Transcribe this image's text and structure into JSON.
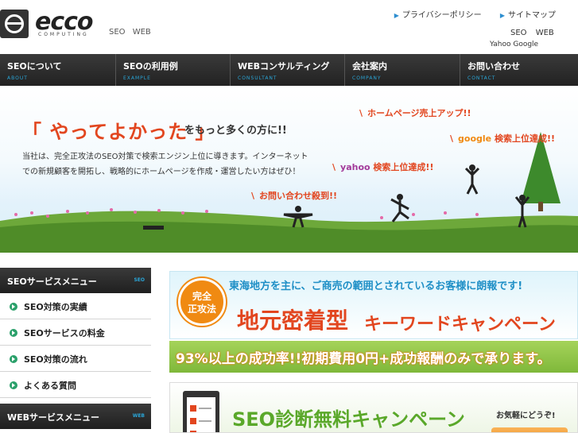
{
  "header": {
    "logo_text": "ecco",
    "logo_sub": "COMPUTING",
    "tagline": "SEO WEB",
    "util_links": [
      "プライバシーポリシー",
      "サイトマップ"
    ],
    "right_line1": "SEO WEB",
    "right_line2": "Yahoo Google"
  },
  "nav": [
    {
      "label": "SEOについて",
      "en": "ABOUT"
    },
    {
      "label": "SEOの利用例",
      "en": "EXAMPLE"
    },
    {
      "label": "WEBコンサルティング",
      "en": "CONSULTANT"
    },
    {
      "label": "会社案内",
      "en": "COMPANY"
    },
    {
      "label": "お問い合わせ",
      "en": "CONTACT"
    }
  ],
  "hero": {
    "title": "「 やってよかった 」",
    "title_sub": "をもっと多くの方に!!",
    "body": "当社は、完全正攻法のSEO対策で検索エンジン上位に導きます。インターネットでの新規顧客を開拓し、戦略的にホームページを作成・運営したい方はぜひ！",
    "tag1": "ホームページ売上アップ!!",
    "tag2_a": "google",
    "tag2_b": "検索上位達成!!",
    "tag3_a": "yahoo",
    "tag3_b": "検索上位達成!!",
    "tag4": "お問い合わせ殺到!!",
    "accent": "#e2461f"
  },
  "sidebar": {
    "seo_head": "SEOサービスメニュー",
    "seo_tag": "SEO",
    "items": [
      "SEO対策の実績",
      "SEOサービスの料金",
      "SEO対策の流れ",
      "よくある質問"
    ],
    "web_head": "WEBサービスメニュー",
    "web_tag": "WEB"
  },
  "banner1": {
    "line1": "東海地方を主に、ご商売の範囲とされているお客様に朗報です!",
    "badge": "完全\n正攻法",
    "big": "地元密着型",
    "big2": "キーワードキャンペーン",
    "bottom": "93%以上の成功率!!初期費用0円+成功報酬のみで承ります。"
  },
  "banner2": {
    "title": "SEO診断無料キャンペーン",
    "right": "お気軽にどうぞ!"
  }
}
